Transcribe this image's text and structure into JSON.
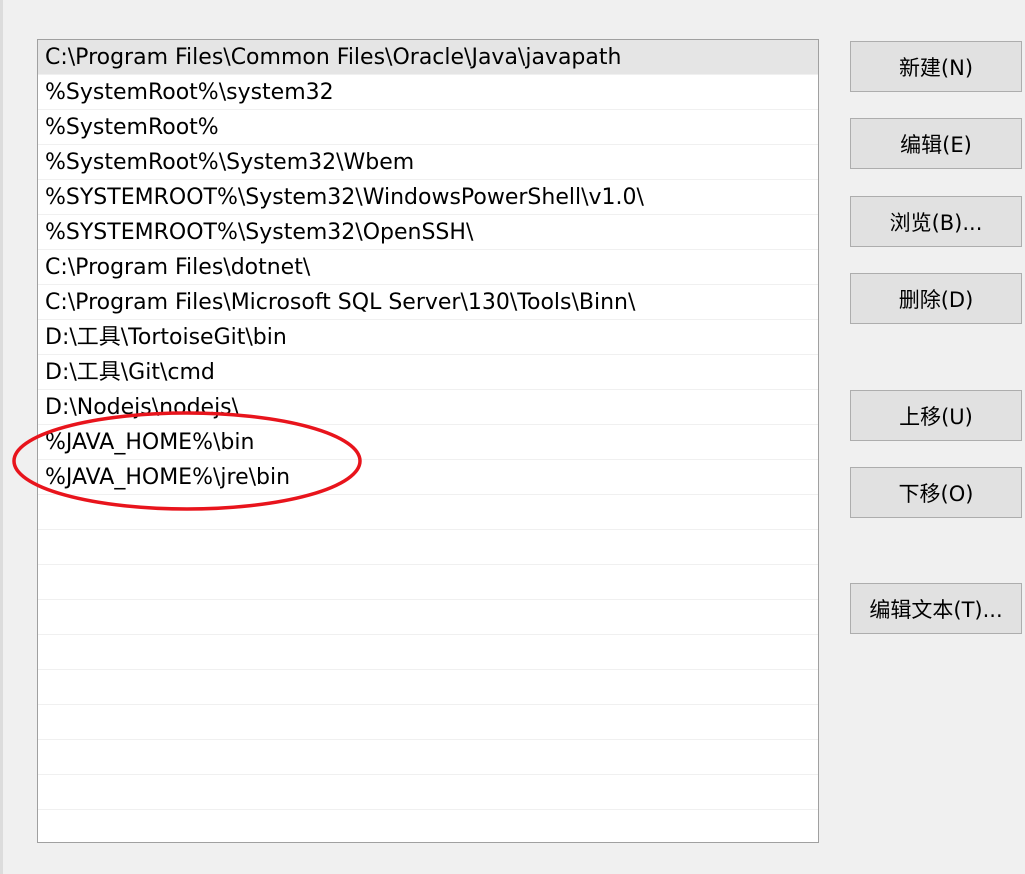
{
  "path_list": {
    "entries": [
      "C:\\Program Files\\Common Files\\Oracle\\Java\\javapath",
      "%SystemRoot%\\system32",
      "%SystemRoot%",
      "%SystemRoot%\\System32\\Wbem",
      "%SYSTEMROOT%\\System32\\WindowsPowerShell\\v1.0\\",
      "%SYSTEMROOT%\\System32\\OpenSSH\\",
      "C:\\Program Files\\dotnet\\",
      "C:\\Program Files\\Microsoft SQL Server\\130\\Tools\\Binn\\",
      "D:\\工具\\TortoiseGit\\bin",
      "D:\\工具\\Git\\cmd",
      "D:\\Nodejs\\nodejs\\",
      "%JAVA_HOME%\\bin",
      "%JAVA_HOME%\\jre\\bin"
    ],
    "selected_index": 0
  },
  "buttons": {
    "new": "新建(N)",
    "edit": "编辑(E)",
    "browse": "浏览(B)...",
    "delete": "删除(D)",
    "move_up": "上移(U)",
    "move_down": "下移(O)",
    "edit_text": "编辑文本(T)..."
  },
  "colors": {
    "annotation": "#e8141c",
    "selection": "#e5e5e5"
  }
}
